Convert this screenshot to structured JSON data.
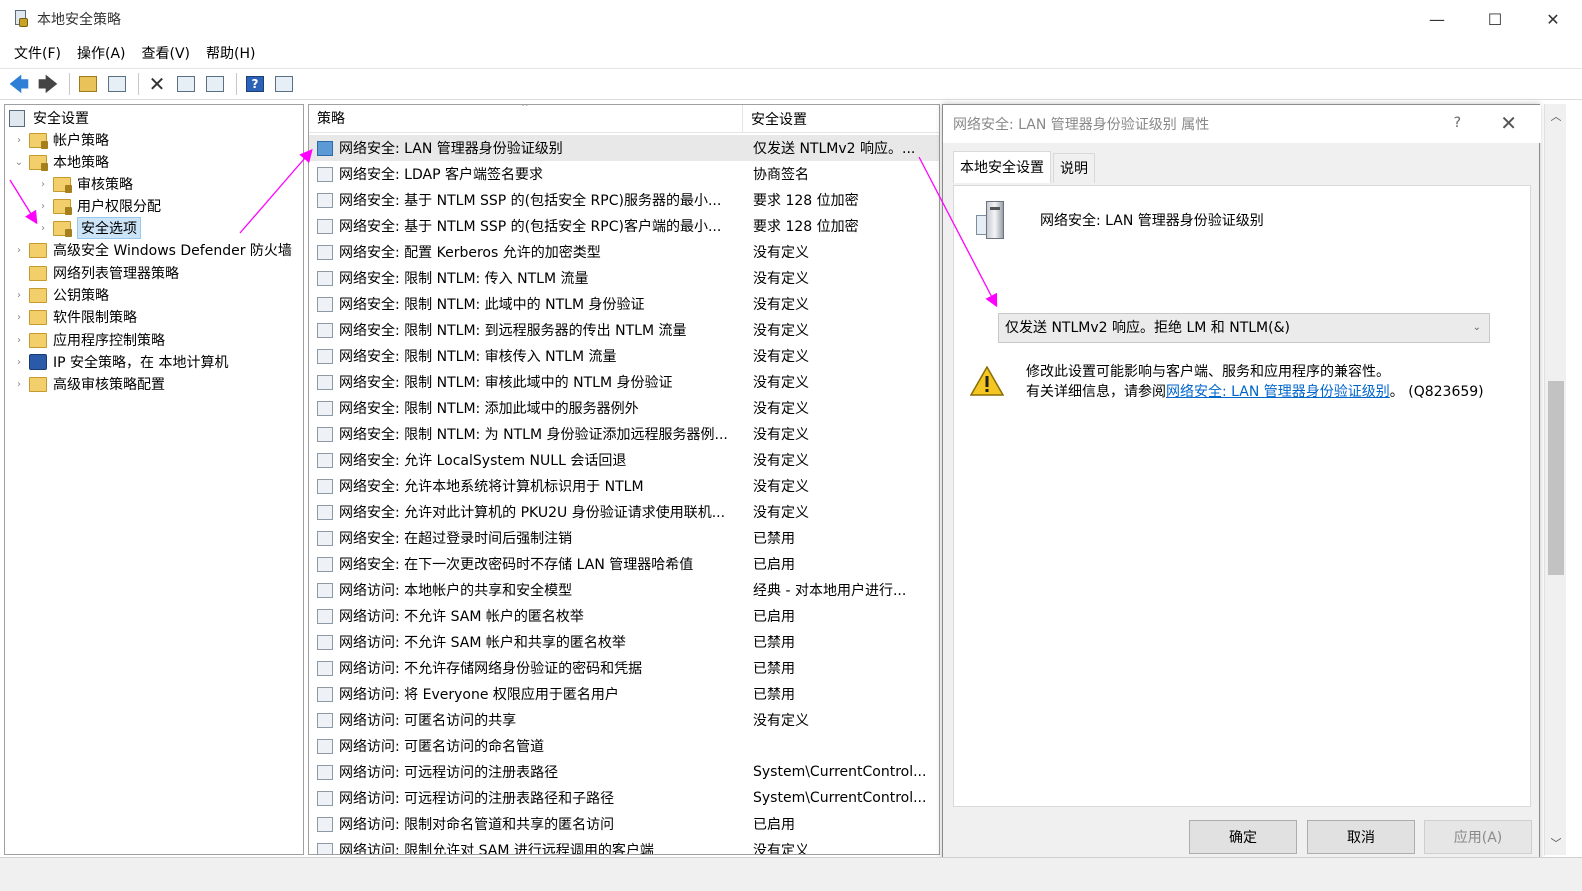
{
  "window": {
    "title": "本地安全策略",
    "controls": {
      "minimize": "—",
      "maximize": "☐",
      "close": "✕"
    }
  },
  "menu": [
    "文件(F)",
    "操作(A)",
    "查看(V)",
    "帮助(H)"
  ],
  "toolbar": {
    "icons": [
      "back-icon",
      "forward-icon",
      "up-folder-icon",
      "show-hide-tree-icon",
      "delete-icon",
      "properties-icon",
      "export-list-icon",
      "help-icon",
      "show-action-pane-icon"
    ]
  },
  "tree": {
    "root": "安全设置",
    "items": [
      {
        "label": "帐户策略",
        "level": 1,
        "expanded": false
      },
      {
        "label": "本地策略",
        "level": 1,
        "expanded": true
      },
      {
        "label": "审核策略",
        "level": 2,
        "expanded": false
      },
      {
        "label": "用户权限分配",
        "level": 2,
        "expanded": false
      },
      {
        "label": "安全选项",
        "level": 2,
        "selected": true
      },
      {
        "label": "高级安全 Windows Defender 防火墙",
        "level": 1
      },
      {
        "label": "网络列表管理器策略",
        "level": 1
      },
      {
        "label": "公钥策略",
        "level": 1
      },
      {
        "label": "软件限制策略",
        "level": 1
      },
      {
        "label": "应用程序控制策略",
        "level": 1
      },
      {
        "label": "IP 安全策略，在 本地计算机",
        "level": 1
      },
      {
        "label": "高级审核策略配置",
        "level": 1
      }
    ]
  },
  "list": {
    "columns": [
      "策略",
      "安全设置"
    ],
    "rows": [
      {
        "name": "网络安全: LAN 管理器身份验证级别",
        "value": "仅发送 NTLMv2 响应。..."
      },
      {
        "name": "网络安全: LDAP 客户端签名要求",
        "value": "协商签名"
      },
      {
        "name": "网络安全: 基于 NTLM SSP 的(包括安全 RPC)服务器的最小...",
        "value": "要求 128 位加密"
      },
      {
        "name": "网络安全: 基于 NTLM SSP 的(包括安全 RPC)客户端的最小...",
        "value": "要求 128 位加密"
      },
      {
        "name": "网络安全: 配置 Kerberos 允许的加密类型",
        "value": "没有定义"
      },
      {
        "name": "网络安全: 限制 NTLM: 传入 NTLM 流量",
        "value": "没有定义"
      },
      {
        "name": "网络安全: 限制 NTLM: 此域中的 NTLM 身份验证",
        "value": "没有定义"
      },
      {
        "name": "网络安全: 限制 NTLM: 到远程服务器的传出 NTLM 流量",
        "value": "没有定义"
      },
      {
        "name": "网络安全: 限制 NTLM: 审核传入 NTLM 流量",
        "value": "没有定义"
      },
      {
        "name": "网络安全: 限制 NTLM: 审核此域中的 NTLM 身份验证",
        "value": "没有定义"
      },
      {
        "name": "网络安全: 限制 NTLM: 添加此域中的服务器例外",
        "value": "没有定义"
      },
      {
        "name": "网络安全: 限制 NTLM: 为 NTLM 身份验证添加远程服务器例...",
        "value": "没有定义"
      },
      {
        "name": "网络安全: 允许 LocalSystem NULL 会话回退",
        "value": "没有定义"
      },
      {
        "name": "网络安全: 允许本地系统将计算机标识用于 NTLM",
        "value": "没有定义"
      },
      {
        "name": "网络安全: 允许对此计算机的 PKU2U 身份验证请求使用联机...",
        "value": "没有定义"
      },
      {
        "name": "网络安全: 在超过登录时间后强制注销",
        "value": "已禁用"
      },
      {
        "name": "网络安全: 在下一次更改密码时不存储 LAN 管理器哈希值",
        "value": "已启用"
      },
      {
        "name": "网络访问: 本地帐户的共享和安全模型",
        "value": "经典 - 对本地用户进行..."
      },
      {
        "name": "网络访问: 不允许 SAM 帐户的匿名枚举",
        "value": "已启用"
      },
      {
        "name": "网络访问: 不允许 SAM 帐户和共享的匿名枚举",
        "value": "已禁用"
      },
      {
        "name": "网络访问: 不允许存储网络身份验证的密码和凭据",
        "value": "已禁用"
      },
      {
        "name": "网络访问: 将 Everyone 权限应用于匿名用户",
        "value": "已禁用"
      },
      {
        "name": "网络访问: 可匿名访问的共享",
        "value": "没有定义"
      },
      {
        "name": "网络访问: 可匿名访问的命名管道",
        "value": ""
      },
      {
        "name": "网络访问: 可远程访问的注册表路径",
        "value": "System\\CurrentControl..."
      },
      {
        "name": "网络访问: 可远程访问的注册表路径和子路径",
        "value": "System\\CurrentControl..."
      },
      {
        "name": "网络访问: 限制对命名管道和共享的匿名访问",
        "value": "已启用"
      },
      {
        "name": "网络访问: 限制允许对 SAM 进行远程调用的客户端",
        "value": "没有定义"
      }
    ]
  },
  "dialog": {
    "title": "网络安全: LAN 管理器身份验证级别 属性",
    "help": "?",
    "close": "✕",
    "tabs": [
      "本地安全设置",
      "说明"
    ],
    "policy_name": "网络安全: LAN 管理器身份验证级别",
    "selected_option": "仅发送 NTLMv2 响应。拒绝 LM 和 NTLM(&)",
    "warning_line1": "修改此设置可能影响与客户端、服务和应用程序的兼容性。",
    "warning_prefix": "有关详细信息，请参阅",
    "warning_link": "网络安全: LAN 管理器身份验证级别",
    "warning_suffix": "。 (Q823659)",
    "buttons": {
      "ok": "确定",
      "cancel": "取消",
      "apply": "应用(A)"
    }
  },
  "colors": {
    "annotation": "#ff00ff",
    "link": "#0066cc",
    "selection": "#cce4f7"
  }
}
